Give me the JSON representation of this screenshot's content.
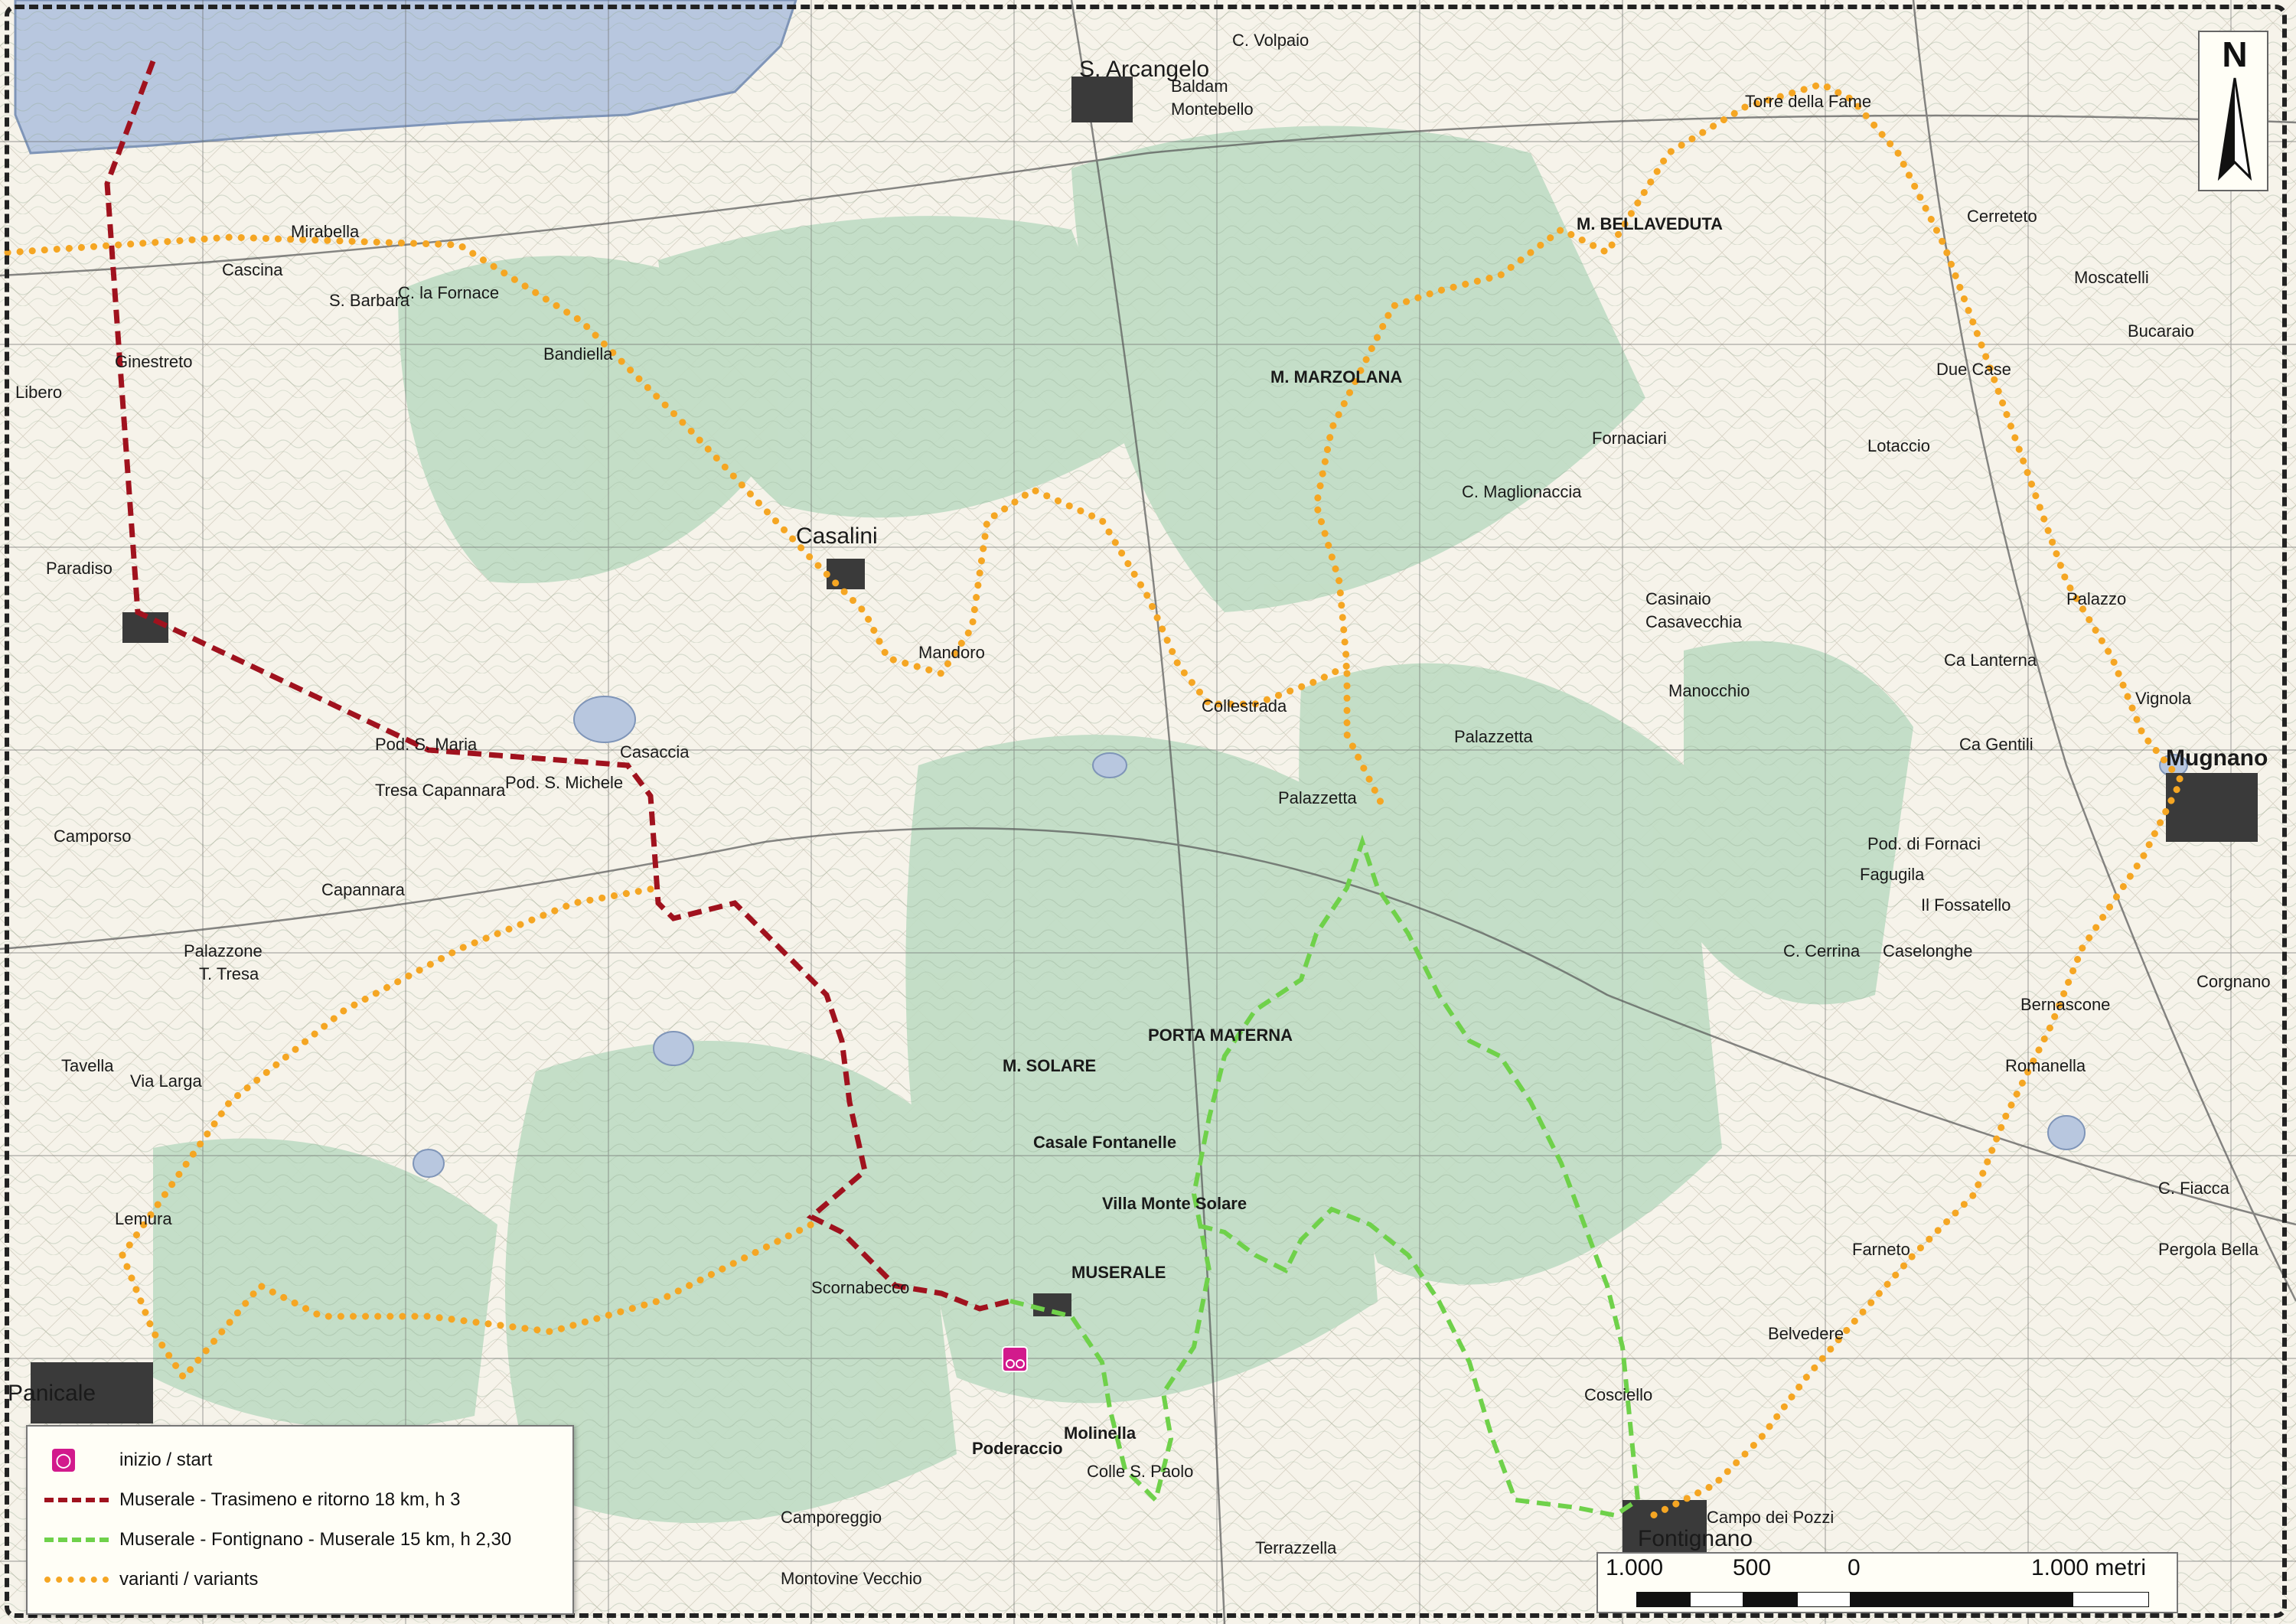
{
  "map": {
    "places": [
      {
        "name": "S. Arcangelo"
      },
      {
        "name": "Mirabella"
      },
      {
        "name": "Casalini"
      },
      {
        "name": "M. BELLAVEDUTA"
      },
      {
        "name": "M. MARZOLANA"
      },
      {
        "name": "Mugnano"
      },
      {
        "name": "Panicale"
      },
      {
        "name": "Fontignano"
      },
      {
        "name": "MUSERALE"
      },
      {
        "name": "Casale Fontanelle"
      },
      {
        "name": "Villa Monte Solare"
      },
      {
        "name": "M. SOLARE"
      },
      {
        "name": "PORTA MATERNA"
      },
      {
        "name": "Molinella"
      },
      {
        "name": "Colle S. Paolo"
      },
      {
        "name": "Poderaccio"
      },
      {
        "name": "Casaccia"
      },
      {
        "name": "Pod. S. Michele"
      },
      {
        "name": "Tresa Capannara"
      },
      {
        "name": "Camporso"
      },
      {
        "name": "Capannara"
      },
      {
        "name": "T. Tresa"
      },
      {
        "name": "Palazzone"
      },
      {
        "name": "Lemura"
      },
      {
        "name": "Tavella"
      },
      {
        "name": "Via Larga"
      },
      {
        "name": "Vignola"
      },
      {
        "name": "Palazzo"
      },
      {
        "name": "Due Case"
      },
      {
        "name": "Torre della Fame"
      },
      {
        "name": "Caselonghe"
      },
      {
        "name": "Romanella"
      },
      {
        "name": "Farneto"
      },
      {
        "name": "Cosciello"
      },
      {
        "name": "Collestrada"
      },
      {
        "name": "Fornaciari"
      },
      {
        "name": "Mandoro"
      },
      {
        "name": "Pod. S. Maria"
      },
      {
        "name": "Paradiso"
      },
      {
        "name": "Libero"
      },
      {
        "name": "Ginestreto"
      },
      {
        "name": "C. la Fornace"
      },
      {
        "name": "Bandiella"
      },
      {
        "name": "Cascina"
      },
      {
        "name": "S. Barbara"
      },
      {
        "name": "Terrazzella"
      },
      {
        "name": "Camporeggio"
      },
      {
        "name": "Montovine Vecchio"
      },
      {
        "name": "Scornabecco"
      },
      {
        "name": "Belvedere"
      },
      {
        "name": "Campo dei Pozzi"
      },
      {
        "name": "Pergola Bella"
      },
      {
        "name": "C. Fiacca"
      },
      {
        "name": "Bernascone"
      },
      {
        "name": "Corgnano"
      },
      {
        "name": "Ca Gentili"
      },
      {
        "name": "Ca Lanterna"
      },
      {
        "name": "Lotaccio"
      },
      {
        "name": "C. Maglionaccia"
      },
      {
        "name": "Casinaio"
      },
      {
        "name": "Casavecchia"
      },
      {
        "name": "Palazzetta"
      },
      {
        "name": "Manocchio"
      },
      {
        "name": "Fagugila"
      },
      {
        "name": "C. Cerrina"
      },
      {
        "name": "Il Fossatello"
      },
      {
        "name": "Pod. di Fornaci"
      },
      {
        "name": "Moscatelli"
      },
      {
        "name": "Cerreteto"
      },
      {
        "name": "Bucaraio"
      },
      {
        "name": "Montebello"
      },
      {
        "name": "C. Volpaio"
      },
      {
        "name": "Baldam"
      },
      {
        "name": "Palazzetta"
      }
    ],
    "legend": {
      "start_label": "inizio / start",
      "red_label": "Muserale - Trasimeno e ritorno 18 km, h 3",
      "green_label": "Muserale - Fontignano - Muserale 15 km, h 2,30",
      "variants_label": "varianti / variants"
    },
    "scale": {
      "labels": [
        "1.000",
        "500",
        "0",
        "1.000 metri"
      ]
    },
    "north_label": "N",
    "colors": {
      "red_route": "#a0121e",
      "green_route": "#6fd14a",
      "variant_route": "#f5a623",
      "lake": "#b8c7df",
      "forest": "#bfdcc4",
      "start_marker": "#d21a8c"
    }
  }
}
